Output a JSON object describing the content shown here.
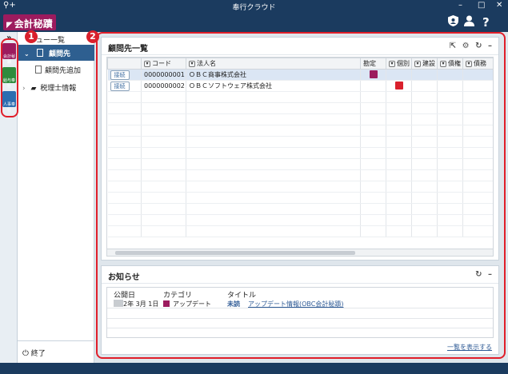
{
  "window": {
    "title": "奉行クラウド"
  },
  "brand": {
    "name": "会計秘蹟"
  },
  "header_icons": {
    "user_shield": "shield-user-icon",
    "user": "user-icon",
    "help_label": "?"
  },
  "apps": [
    {
      "name": "会計秘蹟",
      "color": "#9c1b5e"
    },
    {
      "name": "給与奉行",
      "color": "#2e8b3d"
    },
    {
      "name": "人事奉行",
      "color": "#2c6db0"
    }
  ],
  "nav": {
    "menu_title": "ニュー一覧",
    "expand_label": "»",
    "selected": "顧問先",
    "sub_item": "顧問先追加",
    "other": "税理士情報",
    "exit": "終了"
  },
  "clients_panel": {
    "title": "顧問先一覧",
    "columns": [
      "コード",
      "法人名",
      "勘定",
      "個別",
      "建設",
      "債権",
      "債務"
    ],
    "rows": [
      {
        "action": "接続",
        "code": "0000000001",
        "name": "ＯＢＣ商事株式会社",
        "kanjo": true,
        "kobetsu": false
      },
      {
        "action": "接続",
        "code": "0000000002",
        "name": "ＯＢＣソフトウェア株式会社",
        "kanjo": false,
        "kobetsu": true
      }
    ]
  },
  "news_panel": {
    "title": "お知らせ",
    "columns": [
      "公開日",
      "カテゴリ",
      "タイトル"
    ],
    "rows": [
      {
        "date": "2年 3月 1日",
        "category": "アップデート",
        "status": "未読",
        "title": "アップデート情報(OBC会計秘蹟)"
      }
    ],
    "show_all": "一覧を表示する"
  },
  "callouts": [
    "1",
    "2"
  ],
  "colors": {
    "brand": "#9c1b5e",
    "nav_selected": "#2e5f90",
    "header": "#1b3b5f",
    "callout": "#e01e2a"
  }
}
